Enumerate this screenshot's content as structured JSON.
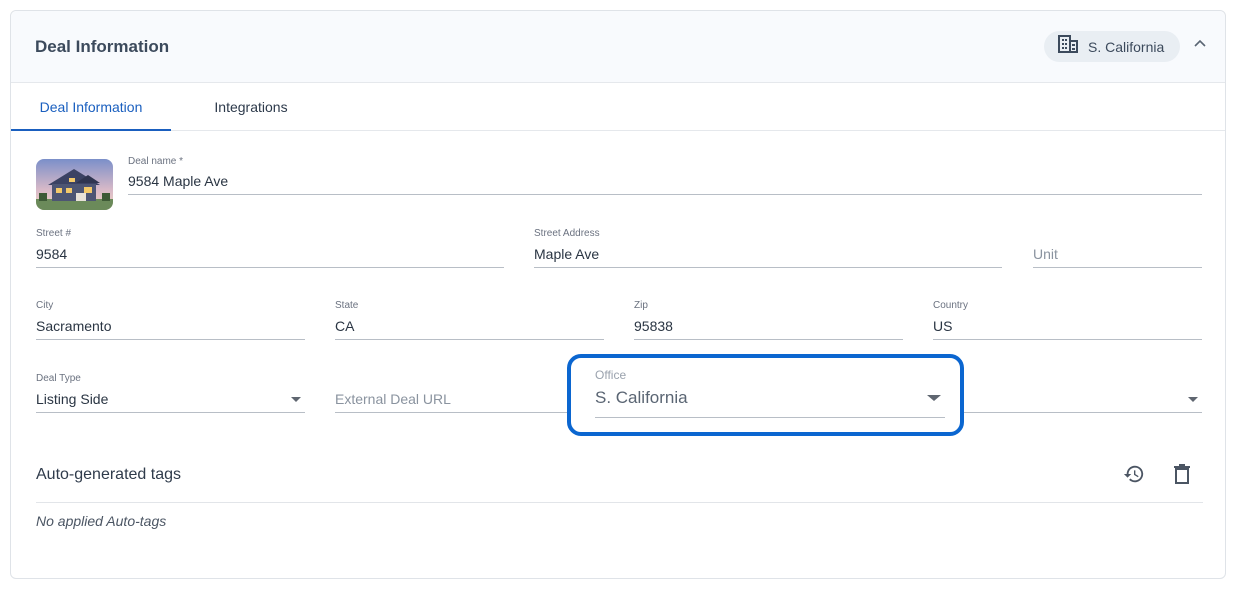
{
  "header": {
    "title": "Deal Information",
    "office_chip": "S. California"
  },
  "tabs": [
    {
      "label": "Deal Information",
      "active": true
    },
    {
      "label": "Integrations",
      "active": false
    }
  ],
  "form": {
    "deal_name": {
      "label": "Deal name *",
      "value": "9584 Maple Ave"
    },
    "street_number": {
      "label": "Street #",
      "value": "9584"
    },
    "street_address": {
      "label": "Street Address",
      "value": "Maple Ave"
    },
    "unit": {
      "placeholder": "Unit"
    },
    "city": {
      "label": "City",
      "value": "Sacramento"
    },
    "state": {
      "label": "State",
      "value": "CA"
    },
    "zip": {
      "label": "Zip",
      "value": "95838"
    },
    "country": {
      "label": "Country",
      "value": "US"
    },
    "deal_type": {
      "label": "Deal Type",
      "value": "Listing Side"
    },
    "external_url": {
      "placeholder": "External Deal URL"
    },
    "office": {
      "label": "Office",
      "value": "S. California"
    }
  },
  "tags": {
    "title": "Auto-generated tags",
    "empty_text": "No applied Auto-tags"
  },
  "colors": {
    "accent": "#1a5fbf",
    "highlight_border": "#0b66d0"
  },
  "icons": {
    "office": "building-icon",
    "collapse": "chevron-up-icon",
    "history": "history-icon",
    "delete": "trash-icon"
  }
}
